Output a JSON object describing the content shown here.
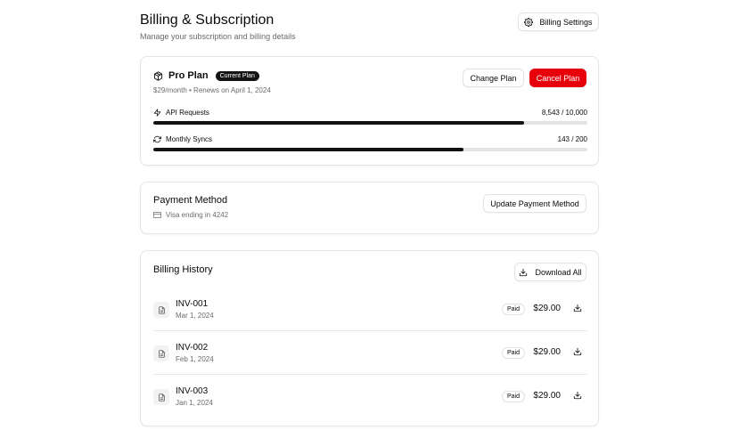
{
  "header": {
    "title": "Billing & Subscription",
    "subtitle": "Manage your subscription and billing details",
    "settings_label": "Billing Settings"
  },
  "plan": {
    "name": "Pro Plan",
    "badge": "Current Plan",
    "meta": "$29/month • Renews on April 1, 2024",
    "change_label": "Change Plan",
    "cancel_label": "Cancel Plan",
    "usage": [
      {
        "label": "API Requests",
        "value": "8,543 / 10,000",
        "fraction": 0.8543,
        "icon": "lightning-icon"
      },
      {
        "label": "Monthly Syncs",
        "value": "143 / 200",
        "fraction": 0.715,
        "icon": "refresh-icon"
      }
    ]
  },
  "payment": {
    "title": "Payment Method",
    "detail": "Visa ending in 4242",
    "update_label": "Update Payment Method"
  },
  "history": {
    "title": "Billing History",
    "download_all_label": "Download All",
    "invoices": [
      {
        "id": "INV-001",
        "date": "Mar 1, 2024",
        "status": "Paid",
        "amount": "$29.00"
      },
      {
        "id": "INV-002",
        "date": "Feb 1, 2024",
        "status": "Paid",
        "amount": "$29.00"
      },
      {
        "id": "INV-003",
        "date": "Jan 1, 2024",
        "status": "Paid",
        "amount": "$29.00"
      }
    ]
  },
  "colors": {
    "accent_danger": "#e7000b",
    "progress_fill": "#121212",
    "progress_track": "#e3e3e3",
    "muted_text": "#6b6b6b"
  }
}
